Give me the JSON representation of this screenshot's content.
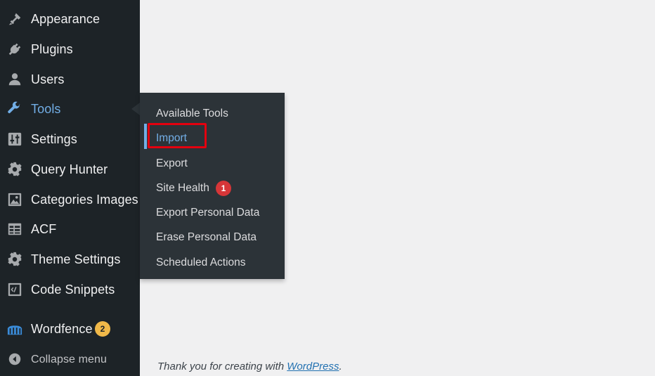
{
  "sidebar": {
    "items": [
      {
        "label": "Appearance",
        "icon": "paintbrush-icon"
      },
      {
        "label": "Plugins",
        "icon": "plugin-icon"
      },
      {
        "label": "Users",
        "icon": "user-icon"
      },
      {
        "label": "Tools",
        "icon": "wrench-icon",
        "current": true
      },
      {
        "label": "Settings",
        "icon": "settings-sliders-icon"
      },
      {
        "label": "Query Hunter",
        "icon": "gear-icon"
      },
      {
        "label": "Categories Images",
        "icon": "image-icon"
      },
      {
        "label": "ACF",
        "icon": "table-icon"
      },
      {
        "label": "Theme Settings",
        "icon": "gear-icon"
      },
      {
        "label": "Code Snippets",
        "icon": "code-icon"
      },
      {
        "label": "Wordfence",
        "icon": "wordfence-icon",
        "badge": "2"
      }
    ],
    "collapse_label": "Collapse menu"
  },
  "submenu": {
    "items": [
      {
        "label": "Available Tools"
      },
      {
        "label": "Import",
        "current": true,
        "highlighted": true
      },
      {
        "label": "Export"
      },
      {
        "label": "Site Health",
        "badge": "1"
      },
      {
        "label": "Export Personal Data"
      },
      {
        "label": "Erase Personal Data"
      },
      {
        "label": "Scheduled Actions"
      }
    ]
  },
  "footer": {
    "text": "Thank you for creating with ",
    "link": "WordPress",
    "period": "."
  },
  "colors": {
    "sidebar_bg": "#1d2327",
    "submenu_bg": "#2c3338",
    "accent": "#72aee6",
    "highlight_border": "#e3000f",
    "badge_yellow": "#f0b849",
    "badge_red": "#d63638",
    "content_bg": "#f0f0f1"
  }
}
